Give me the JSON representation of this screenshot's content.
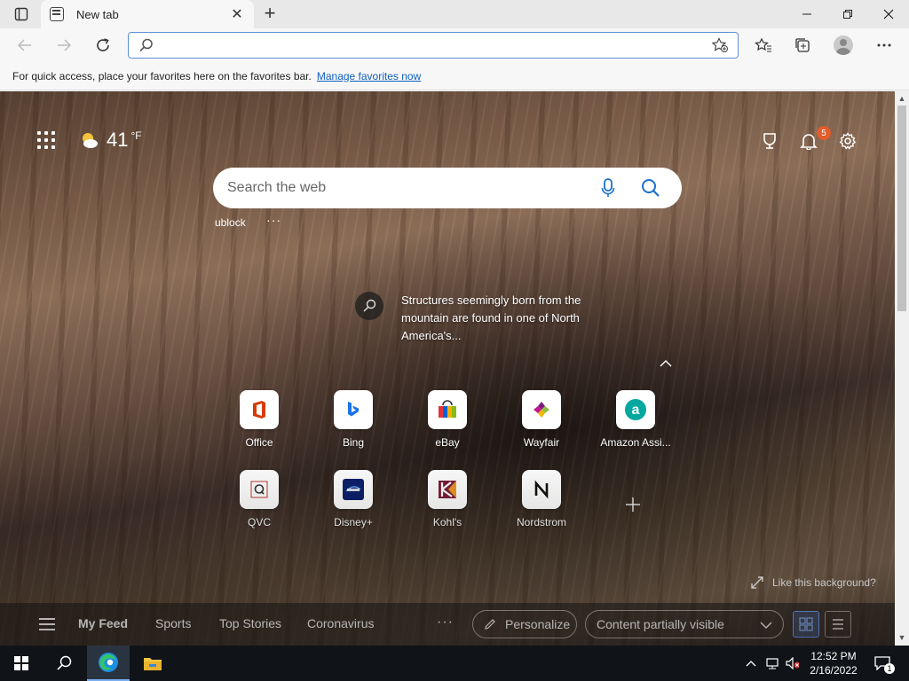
{
  "browser": {
    "tab_title": "New tab",
    "new_tab_symbol": "+",
    "tab_close_symbol": "✕",
    "address_value": "",
    "window_controls": [
      "minimize",
      "restore",
      "close"
    ]
  },
  "favorites_bar": {
    "message": "For quick access, place your favorites here on the favorites bar.",
    "link": "Manage favorites now"
  },
  "new_tab_page": {
    "weather": {
      "temperature": "41",
      "unit": "°F",
      "icon": "partly-cloudy-icon"
    },
    "notifications_count": "5",
    "search": {
      "placeholder": "Search the web"
    },
    "quick_link": "ublock",
    "quick_link_more": "···",
    "background_caption": "Structures seemingly born from the mountain are found in one of North America's...",
    "tiles": [
      {
        "label": "Office",
        "icon": "office-icon"
      },
      {
        "label": "Bing",
        "icon": "bing-icon"
      },
      {
        "label": "eBay",
        "icon": "ebay-icon"
      },
      {
        "label": "Wayfair",
        "icon": "wayfair-icon"
      },
      {
        "label": "Amazon Assi...",
        "icon": "amazon-assistant-icon"
      },
      {
        "label": "QVC",
        "icon": "qvc-icon"
      },
      {
        "label": "Disney+",
        "icon": "disney-plus-icon"
      },
      {
        "label": "Kohl's",
        "icon": "kohls-icon"
      },
      {
        "label": "Nordstrom",
        "icon": "nordstrom-icon"
      }
    ],
    "like_background": "Like this background?",
    "feed": {
      "tabs": [
        "My Feed",
        "Sports",
        "Top Stories",
        "Coronavirus"
      ],
      "more": "···",
      "personalize": "Personalize",
      "content_visibility": "Content partially visible"
    }
  },
  "taskbar": {
    "time": "12:52 PM",
    "date": "2/16/2022",
    "notification_count": "1"
  }
}
